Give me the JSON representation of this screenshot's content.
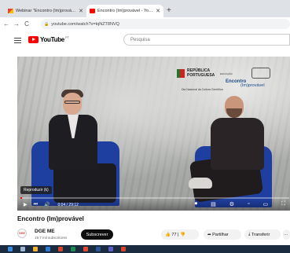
{
  "browser": {
    "tabs": [
      {
        "title": "Webinar \"Encontro (Im)provável\"",
        "active": false
      },
      {
        "title": "Encontro (Im)provável - YouTube",
        "active": true
      }
    ],
    "new_tab": "+",
    "url": "youtube.com/watch?v=tqNZT8NVQ"
  },
  "youtube": {
    "logo_text": "YouTube",
    "country": "PT",
    "search_placeholder": "Pesquisa"
  },
  "video": {
    "overlay_brand_1": "REPÚBLICA PORTUGUESA",
    "overlay_brand_2": "EDUCAÇÃO",
    "overlay_title_1": "Encontro",
    "overlay_title_2": "(Im)provável",
    "overlay_subtitle": "Dia Nacional da Cultura Científica",
    "tooltip": "Reproduzir (k)",
    "time": "0:04 / 29:12",
    "progress": 0.002
  },
  "meta": {
    "title": "Encontro (Im)provável",
    "channel": "DGE ME",
    "avatar_text": "DGE",
    "subscribers": "19,7 mil subscritores",
    "subscribe_label": "Subscrever",
    "likes": "77",
    "share_label": "Partilhar",
    "download_label": "Transferir",
    "more_label": "···"
  },
  "colors": {
    "accent": "#ff0000",
    "chair": "#1f3fa0",
    "taskbar": "#1b2b40"
  }
}
